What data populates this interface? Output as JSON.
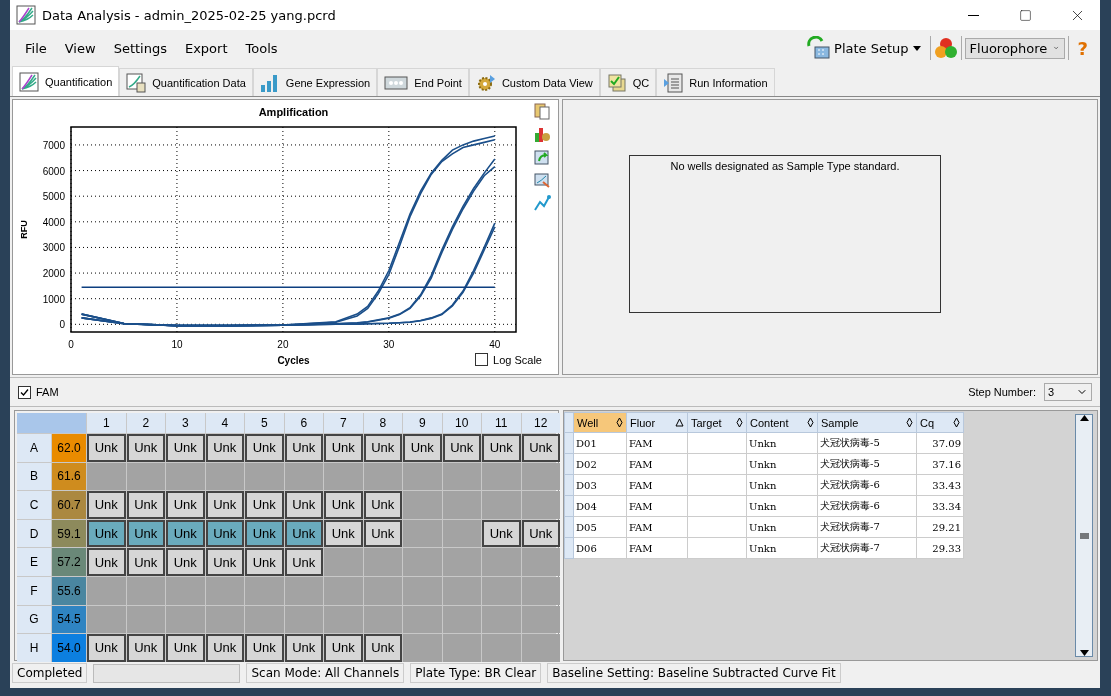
{
  "window": {
    "title": "Data Analysis - admin_2025-02-25 yang.pcrd"
  },
  "menu": [
    "File",
    "View",
    "Settings",
    "Export",
    "Tools"
  ],
  "toolbar": {
    "plate_setup": "Plate Setup",
    "fluorophore_select": "Fluorophore",
    "help": "?"
  },
  "tabs": [
    {
      "label": "Quantification",
      "selected": true
    },
    {
      "label": "Quantification Data",
      "selected": false
    },
    {
      "label": "Gene Expression",
      "selected": false
    },
    {
      "label": "End Point",
      "selected": false
    },
    {
      "label": "Custom Data View",
      "selected": false
    },
    {
      "label": "QC",
      "selected": false
    },
    {
      "label": "Run Information",
      "selected": false
    }
  ],
  "amplification": {
    "log_scale": {
      "label": "Log Scale",
      "checked": false
    },
    "chart_data": {
      "type": "line",
      "grid": true,
      "title": "Amplification",
      "xlabel": "Cycles",
      "ylabel": "RFU",
      "x": [
        1,
        5,
        10,
        15,
        20,
        25,
        27,
        28,
        29,
        30,
        31,
        32,
        33,
        34,
        35,
        36,
        37,
        38,
        39,
        40
      ],
      "xlim": [
        0,
        42
      ],
      "ylim": [
        -300,
        7700
      ],
      "xticks": [
        0,
        10,
        20,
        30,
        40
      ],
      "yticks": [
        0,
        1000,
        2000,
        3000,
        4000,
        5000,
        6000,
        7000
      ],
      "series": [
        {
          "color": "#1b4f8a",
          "values": [
            400,
            30,
            -50,
            -50,
            -30,
            100,
            400,
            700,
            1300,
            2100,
            3200,
            4300,
            5200,
            5900,
            6400,
            6800,
            7000,
            7150,
            7250,
            7350
          ]
        },
        {
          "color": "#1b4f8a",
          "values": [
            250,
            20,
            -50,
            -50,
            -30,
            80,
            330,
            620,
            1200,
            1950,
            3050,
            4200,
            5100,
            5850,
            6350,
            6650,
            6900,
            7000,
            7100,
            7200
          ]
        },
        {
          "color": "#1b4f8a",
          "values": [
            400,
            30,
            -50,
            -50,
            -30,
            20,
            60,
            100,
            180,
            260,
            400,
            650,
            1150,
            1900,
            2900,
            3800,
            4600,
            5300,
            5900,
            6450
          ]
        },
        {
          "color": "#1b4f8a",
          "values": [
            250,
            20,
            -50,
            -50,
            -30,
            20,
            50,
            90,
            160,
            240,
            380,
            620,
            1100,
            1800,
            2800,
            3700,
            4500,
            5200,
            5800,
            6150
          ]
        },
        {
          "color": "#1b4f8a",
          "values": [
            400,
            30,
            -50,
            -50,
            -30,
            0,
            10,
            20,
            30,
            40,
            60,
            90,
            150,
            250,
            400,
            750,
            1300,
            2100,
            3000,
            3950
          ]
        },
        {
          "color": "#1b4f8a",
          "values": [
            250,
            20,
            -50,
            -50,
            -30,
            0,
            10,
            20,
            30,
            40,
            60,
            80,
            140,
            230,
            380,
            720,
            1250,
            2000,
            2900,
            3800
          ]
        },
        {
          "color": "#0d3f80",
          "values": [
            1450,
            1450,
            1450,
            1450,
            1450,
            1450,
            1450,
            1450,
            1450,
            1450,
            1450,
            1450,
            1450,
            1450,
            1450,
            1450,
            1450,
            1450,
            1450,
            1450
          ]
        }
      ]
    }
  },
  "standard_curve": {
    "message": "No wells designated as Sample Type standard."
  },
  "fluor_filter": {
    "label": "FAM",
    "checked": true
  },
  "step_number": {
    "label": "Step Number:",
    "value": "3"
  },
  "plate": {
    "columns": [
      "1",
      "2",
      "3",
      "4",
      "5",
      "6",
      "7",
      "8",
      "9",
      "10",
      "11",
      "12"
    ],
    "rows": [
      {
        "label": "A",
        "temp": "62.0",
        "color": "#e98b00",
        "wells": [
          {
            "kind": "sample",
            "label": "Unk",
            "selected": false
          },
          {
            "kind": "sample",
            "label": "Unk",
            "selected": false
          },
          {
            "kind": "sample",
            "label": "Unk",
            "selected": false
          },
          {
            "kind": "sample",
            "label": "Unk",
            "selected": false
          },
          {
            "kind": "sample",
            "label": "Unk",
            "selected": false
          },
          {
            "kind": "sample",
            "label": "Unk",
            "selected": false
          },
          {
            "kind": "sample",
            "label": "Unk",
            "selected": false
          },
          {
            "kind": "sample",
            "label": "Unk",
            "selected": false
          },
          {
            "kind": "sample",
            "label": "Unk",
            "selected": false
          },
          {
            "kind": "sample",
            "label": "Unk",
            "selected": false
          },
          {
            "kind": "sample",
            "label": "Unk",
            "selected": false
          },
          {
            "kind": "sample",
            "label": "Unk",
            "selected": false
          }
        ]
      },
      {
        "label": "B",
        "temp": "61.6",
        "color": "#cf8c1e",
        "wells": [
          {
            "kind": "empty"
          },
          {
            "kind": "empty"
          },
          {
            "kind": "empty"
          },
          {
            "kind": "empty"
          },
          {
            "kind": "empty"
          },
          {
            "kind": "empty"
          },
          {
            "kind": "empty"
          },
          {
            "kind": "empty"
          },
          {
            "kind": "empty"
          },
          {
            "kind": "empty"
          },
          {
            "kind": "empty"
          },
          {
            "kind": "empty"
          }
        ]
      },
      {
        "label": "C",
        "temp": "60.7",
        "color": "#ab8840",
        "wells": [
          {
            "kind": "sample",
            "label": "Unk",
            "selected": false
          },
          {
            "kind": "sample",
            "label": "Unk",
            "selected": false
          },
          {
            "kind": "sample",
            "label": "Unk",
            "selected": false
          },
          {
            "kind": "sample",
            "label": "Unk",
            "selected": false
          },
          {
            "kind": "sample",
            "label": "Unk",
            "selected": false
          },
          {
            "kind": "sample",
            "label": "Unk",
            "selected": false
          },
          {
            "kind": "sample",
            "label": "Unk",
            "selected": false
          },
          {
            "kind": "sample",
            "label": "Unk",
            "selected": false
          },
          {
            "kind": "empty"
          },
          {
            "kind": "empty"
          },
          {
            "kind": "empty"
          },
          {
            "kind": "empty"
          }
        ]
      },
      {
        "label": "D",
        "temp": "59.1",
        "color": "#8d8a5c",
        "wells": [
          {
            "kind": "sample",
            "label": "Unk",
            "selected": true
          },
          {
            "kind": "sample",
            "label": "Unk",
            "selected": true
          },
          {
            "kind": "sample",
            "label": "Unk",
            "selected": true
          },
          {
            "kind": "sample",
            "label": "Unk",
            "selected": true
          },
          {
            "kind": "sample",
            "label": "Unk",
            "selected": true
          },
          {
            "kind": "sample",
            "label": "Unk",
            "selected": true
          },
          {
            "kind": "sample",
            "label": "Unk",
            "selected": false
          },
          {
            "kind": "sample",
            "label": "Unk",
            "selected": false
          },
          {
            "kind": "empty"
          },
          {
            "kind": "empty"
          },
          {
            "kind": "sample",
            "label": "Unk",
            "selected": false
          },
          {
            "kind": "sample",
            "label": "Unk",
            "selected": false
          }
        ]
      },
      {
        "label": "E",
        "temp": "57.2",
        "color": "#6a8878",
        "wells": [
          {
            "kind": "sample",
            "label": "Unk",
            "selected": false
          },
          {
            "kind": "sample",
            "label": "Unk",
            "selected": false
          },
          {
            "kind": "sample",
            "label": "Unk",
            "selected": false
          },
          {
            "kind": "sample",
            "label": "Unk",
            "selected": false
          },
          {
            "kind": "sample",
            "label": "Unk",
            "selected": false
          },
          {
            "kind": "sample",
            "label": "Unk",
            "selected": false
          },
          {
            "kind": "empty"
          },
          {
            "kind": "empty"
          },
          {
            "kind": "empty"
          },
          {
            "kind": "empty"
          },
          {
            "kind": "empty"
          },
          {
            "kind": "empty"
          }
        ]
      },
      {
        "label": "F",
        "temp": "55.6",
        "color": "#4a86a0",
        "wells": [
          {
            "kind": "empty"
          },
          {
            "kind": "empty"
          },
          {
            "kind": "empty"
          },
          {
            "kind": "empty"
          },
          {
            "kind": "empty"
          },
          {
            "kind": "empty"
          },
          {
            "kind": "empty"
          },
          {
            "kind": "empty"
          },
          {
            "kind": "empty"
          },
          {
            "kind": "empty"
          },
          {
            "kind": "empty"
          },
          {
            "kind": "empty"
          }
        ]
      },
      {
        "label": "G",
        "temp": "54.5",
        "color": "#2f84c2",
        "wells": [
          {
            "kind": "empty"
          },
          {
            "kind": "empty"
          },
          {
            "kind": "empty"
          },
          {
            "kind": "empty"
          },
          {
            "kind": "empty"
          },
          {
            "kind": "empty"
          },
          {
            "kind": "empty"
          },
          {
            "kind": "empty"
          },
          {
            "kind": "empty"
          },
          {
            "kind": "empty"
          },
          {
            "kind": "empty"
          },
          {
            "kind": "empty"
          }
        ]
      },
      {
        "label": "H",
        "temp": "54.0",
        "color": "#0c7fe0",
        "wells": [
          {
            "kind": "sample",
            "label": "Unk",
            "selected": false
          },
          {
            "kind": "sample",
            "label": "Unk",
            "selected": false
          },
          {
            "kind": "sample",
            "label": "Unk",
            "selected": false
          },
          {
            "kind": "sample",
            "label": "Unk",
            "selected": false
          },
          {
            "kind": "sample",
            "label": "Unk",
            "selected": false
          },
          {
            "kind": "sample",
            "label": "Unk",
            "selected": false
          },
          {
            "kind": "sample",
            "label": "Unk",
            "selected": false
          },
          {
            "kind": "sample",
            "label": "Unk",
            "selected": false
          },
          {
            "kind": "empty"
          },
          {
            "kind": "empty"
          },
          {
            "kind": "empty"
          },
          {
            "kind": "empty"
          }
        ]
      }
    ]
  },
  "results": {
    "columns": [
      {
        "label": "Well",
        "sorted": false,
        "selected": true
      },
      {
        "label": "Fluor",
        "sorted": true,
        "selected": false
      },
      {
        "label": "Target",
        "sorted": false,
        "selected": false
      },
      {
        "label": "Content",
        "sorted": false,
        "selected": false
      },
      {
        "label": "Sample",
        "sorted": false,
        "selected": false
      },
      {
        "label": "Cq",
        "sorted": false,
        "selected": false
      }
    ],
    "rows": [
      [
        "D01",
        "FAM",
        null,
        "Unkn",
        "犬冠状病毒-5",
        "37.09"
      ],
      [
        "D02",
        "FAM",
        null,
        "Unkn",
        "犬冠状病毒-5",
        "37.16"
      ],
      [
        "D03",
        "FAM",
        null,
        "Unkn",
        "犬冠状病毒-6",
        "33.43"
      ],
      [
        "D04",
        "FAM",
        null,
        "Unkn",
        "犬冠状病毒-6",
        "33.34"
      ],
      [
        "D05",
        "FAM",
        null,
        "Unkn",
        "犬冠状病毒-7",
        "29.21"
      ],
      [
        "D06",
        "FAM",
        null,
        "Unkn",
        "犬冠状病毒-7",
        "29.33"
      ]
    ]
  },
  "progress": {
    "level": 0
  },
  "status_bar": [
    "Completed",
    "Scan Mode: All Channels",
    "Plate Type: BR Clear",
    "Baseline Setting: Baseline Subtracted Curve Fit"
  ]
}
